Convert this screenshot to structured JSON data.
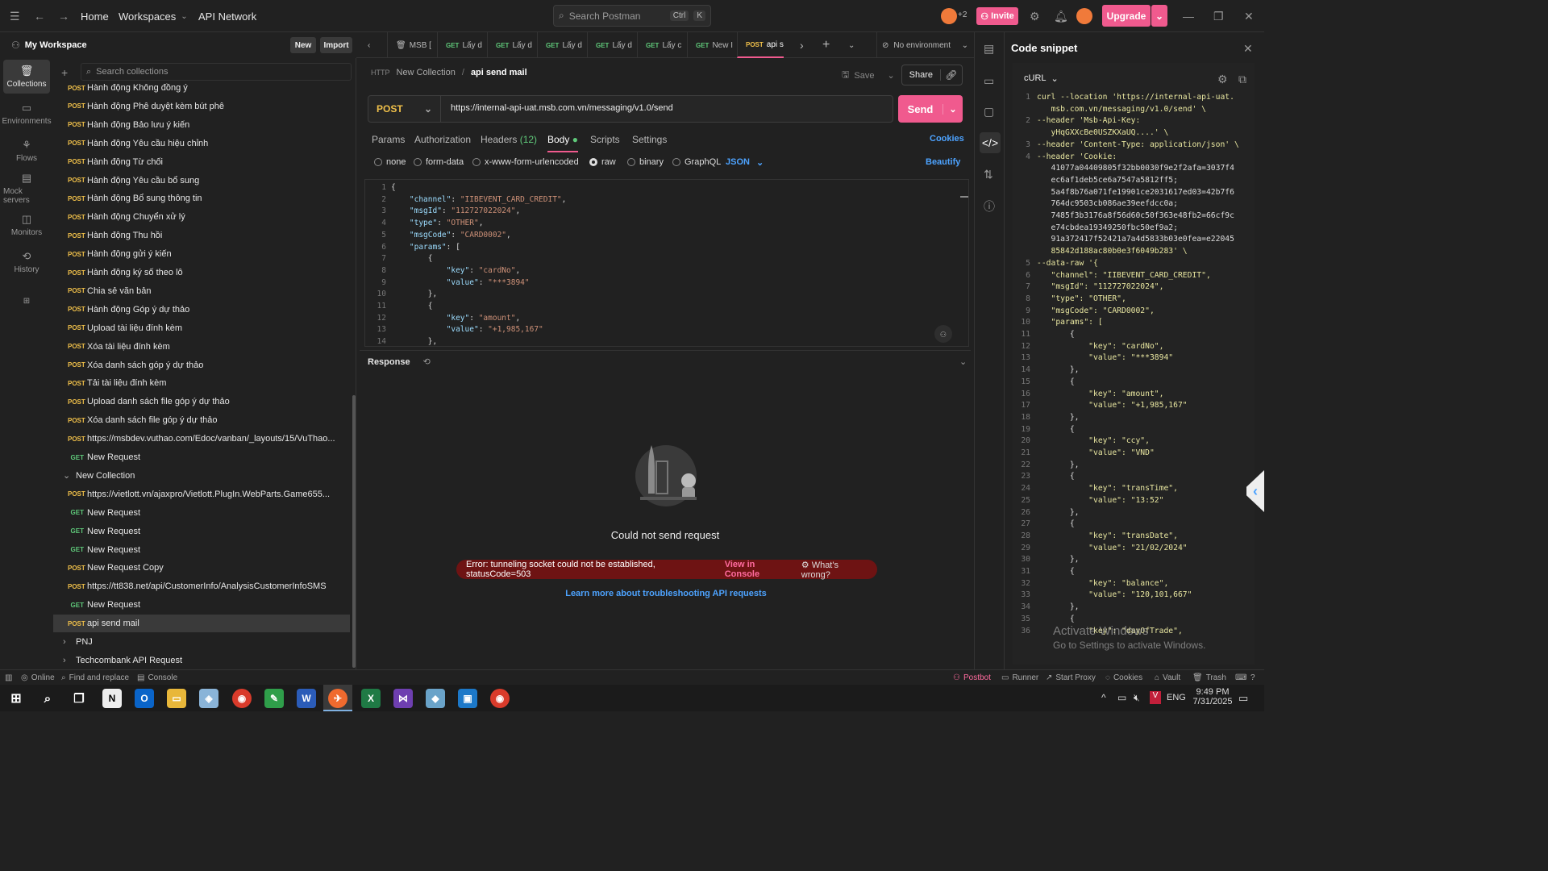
{
  "topbar": {
    "home": "Home",
    "workspaces": "Workspaces",
    "api_network": "API Network",
    "search_placeholder": "Search Postman",
    "kbd_ctrl": "Ctrl",
    "kbd_k": "K",
    "avatar_count": "+2",
    "invite": "Invite",
    "upgrade": "Upgrade"
  },
  "workspace": {
    "title": "My Workspace",
    "new": "New",
    "import": "Import",
    "search_placeholder": "Search collections"
  },
  "rail": [
    {
      "label": "Collections",
      "icon": "trash-can-icon"
    },
    {
      "label": "Environments",
      "icon": "environment-icon"
    },
    {
      "label": "Flows",
      "icon": "flows-icon"
    },
    {
      "label": "Mock servers",
      "icon": "mock-server-icon"
    },
    {
      "label": "Monitors",
      "icon": "monitor-icon"
    },
    {
      "label": "History",
      "icon": "history-icon"
    }
  ],
  "tree": [
    {
      "method": "POST",
      "label": "Hành động Không đồng ý"
    },
    {
      "method": "POST",
      "label": "Hành động Phê duyệt kèm bút phê"
    },
    {
      "method": "POST",
      "label": "Hành động Bảo lưu ý kiến"
    },
    {
      "method": "POST",
      "label": "Hành động Yêu cầu hiệu chỉnh"
    },
    {
      "method": "POST",
      "label": "Hành động Từ chối"
    },
    {
      "method": "POST",
      "label": "Hành động Yêu cầu bổ sung"
    },
    {
      "method": "POST",
      "label": "Hành động Bổ sung thông tin"
    },
    {
      "method": "POST",
      "label": "Hành động Chuyển xử lý"
    },
    {
      "method": "POST",
      "label": "Hành động Thu hồi"
    },
    {
      "method": "POST",
      "label": "Hành động gửi ý kiến"
    },
    {
      "method": "POST",
      "label": "Hành động ký số theo lô"
    },
    {
      "method": "POST",
      "label": "Chia sẻ văn bản"
    },
    {
      "method": "POST",
      "label": "Hành động Góp ý dự thảo"
    },
    {
      "method": "POST",
      "label": "Upload tài liệu đính kèm"
    },
    {
      "method": "POST",
      "label": "Xóa tài liệu đính kèm"
    },
    {
      "method": "POST",
      "label": "Xóa danh sách góp ý dự thảo"
    },
    {
      "method": "POST",
      "label": "Tải tài liệu đính kèm"
    },
    {
      "method": "POST",
      "label": "Upload danh sách file góp ý dự thảo"
    },
    {
      "method": "POST",
      "label": "Xóa danh sách file góp ý dự thảo"
    },
    {
      "method": "POST",
      "label": "https://msbdev.vuthao.com/Edoc/vanban/_layouts/15/VuThao..."
    },
    {
      "method": "GET",
      "label": "New Request"
    },
    {
      "method": "",
      "label": "New Collection",
      "folder": true,
      "open": true
    },
    {
      "method": "POST",
      "label": "https://vietlott.vn/ajaxpro/Vietlott.PlugIn.WebParts.Game655..."
    },
    {
      "method": "GET",
      "label": "New Request"
    },
    {
      "method": "GET",
      "label": "New Request"
    },
    {
      "method": "GET",
      "label": "New Request"
    },
    {
      "method": "POST",
      "label": "New Request Copy"
    },
    {
      "method": "POST",
      "label": "https://tt838.net/api/CustomerInfo/AnalysisCustomerInfoSMS"
    },
    {
      "method": "GET",
      "label": "New Request"
    },
    {
      "method": "POST",
      "label": "api send mail",
      "selected": true
    },
    {
      "method": "",
      "label": "PNJ",
      "folder": true
    },
    {
      "method": "",
      "label": "Techcombank API Request",
      "folder": true
    }
  ],
  "tabs": [
    {
      "method": "",
      "label": "MSB [",
      "icon": "trash-can-icon"
    },
    {
      "method": "GET",
      "label": "Lấy d"
    },
    {
      "method": "GET",
      "label": "Lấy d"
    },
    {
      "method": "GET",
      "label": "Lấy d"
    },
    {
      "method": "GET",
      "label": "Lấy d"
    },
    {
      "method": "GET",
      "label": "Lấy c",
      "dot": true
    },
    {
      "method": "GET",
      "label": "New I"
    },
    {
      "method": "POST",
      "label": "api s",
      "active": true
    }
  ],
  "environment": "No environment",
  "request": {
    "breadcrumb_collection": "New Collection",
    "breadcrumb_sep": "/",
    "name": "api send mail",
    "save": "Save",
    "share": "Share",
    "method": "POST",
    "url": "https://internal-api-uat.msb.com.vn/messaging/v1.0/send",
    "send": "Send",
    "cookies": "Cookies",
    "beautify": "Beautify",
    "body_format": "JSON"
  },
  "subtabs": {
    "params": "Params",
    "authorization": "Authorization",
    "headers": "Headers",
    "headers_count": "(12)",
    "body": "Body",
    "scripts": "Scripts",
    "settings": "Settings"
  },
  "body_types": [
    "none",
    "form-data",
    "x-www-form-urlencoded",
    "raw",
    "binary",
    "GraphQL"
  ],
  "body_selected": "raw",
  "editor_lines": [
    {
      "n": "1",
      "i": 0,
      "t": "{"
    },
    {
      "n": "2",
      "i": 1,
      "k": "\"channel\"",
      "v": "\"IIBEVENT_CARD_CREDIT\"",
      "e": ","
    },
    {
      "n": "3",
      "i": 1,
      "k": "\"msgId\"",
      "v": "\"112727022024\"",
      "e": ","
    },
    {
      "n": "4",
      "i": 1,
      "k": "\"type\"",
      "v": "\"OTHER\"",
      "e": ","
    },
    {
      "n": "5",
      "i": 1,
      "k": "\"msgCode\"",
      "v": "\"CARD0002\"",
      "e": ","
    },
    {
      "n": "6",
      "i": 1,
      "k": "\"params\"",
      "t": "["
    },
    {
      "n": "7",
      "i": 2,
      "t": "{"
    },
    {
      "n": "8",
      "i": 3,
      "k": "\"key\"",
      "v": "\"cardNo\"",
      "e": ","
    },
    {
      "n": "9",
      "i": 3,
      "k": "\"value\"",
      "v": "\"***3894\""
    },
    {
      "n": "10",
      "i": 2,
      "t": "},"
    },
    {
      "n": "11",
      "i": 2,
      "t": "{"
    },
    {
      "n": "12",
      "i": 3,
      "k": "\"key\"",
      "v": "\"amount\"",
      "e": ","
    },
    {
      "n": "13",
      "i": 3,
      "k": "\"value\"",
      "v": "\"+1,985,167\""
    },
    {
      "n": "14",
      "i": 2,
      "t": "},"
    }
  ],
  "response": {
    "title": "Response",
    "empty": "Could not send request",
    "error": "Error: tunneling socket could not be established, statusCode=503",
    "view_console": "View in Console",
    "whats_wrong": "What's wrong?",
    "learn_more": "Learn more about troubleshooting API requests"
  },
  "snippet": {
    "title": "Code snippet",
    "language": "cURL",
    "lines": [
      {
        "n": "1",
        "t": "curl --location 'https://internal-api-uat."
      },
      {
        "n": "",
        "t": "   msb.com.vn/messaging/v1.0/send' \\"
      },
      {
        "n": "2",
        "t": "--header 'Msb-Api-Key:"
      },
      {
        "n": "",
        "t": "   yHqGXXcBe0USZKXaUQ....' \\"
      },
      {
        "n": "3",
        "t": "--header 'Content-Type: application/json' \\"
      },
      {
        "n": "4",
        "t": "--header 'Cookie:"
      },
      {
        "n": "",
        "t": "   41077a04409805f32bb0030f9e2f2afa=3037f4"
      },
      {
        "n": "",
        "t": "   ec6af1deb5ce6a7547a5812ff5;"
      },
      {
        "n": "",
        "t": "   5a4f8b76a071fe19901ce2031617ed03=42b7f6"
      },
      {
        "n": "",
        "t": "   764dc9503cb086ae39eefdcc0a;"
      },
      {
        "n": "",
        "t": "   7485f3b3176a8f56d60c50f363e48fb2=66cf9c"
      },
      {
        "n": "",
        "t": "   e74cbdea19349250fbc50ef9a2;"
      },
      {
        "n": "",
        "t": "   91a372417f52421a7a4d5833b03e0fea=e22045"
      },
      {
        "n": "",
        "t": "   85842d188ac80b0e3f6049b283' \\"
      },
      {
        "n": "5",
        "t": "--data-raw '{"
      },
      {
        "n": "6",
        "t": "   \"channel\": \"IIBEVENT_CARD_CREDIT\","
      },
      {
        "n": "7",
        "t": "   \"msgId\": \"112727022024\","
      },
      {
        "n": "8",
        "t": "   \"type\": \"OTHER\","
      },
      {
        "n": "9",
        "t": "   \"msgCode\": \"CARD0002\","
      },
      {
        "n": "10",
        "t": "   \"params\": ["
      },
      {
        "n": "11",
        "t": "       {"
      },
      {
        "n": "12",
        "t": "           \"key\": \"cardNo\","
      },
      {
        "n": "13",
        "t": "           \"value\": \"***3894\""
      },
      {
        "n": "14",
        "t": "       },"
      },
      {
        "n": "15",
        "t": "       {"
      },
      {
        "n": "16",
        "t": "           \"key\": \"amount\","
      },
      {
        "n": "17",
        "t": "           \"value\": \"+1,985,167\""
      },
      {
        "n": "18",
        "t": "       },"
      },
      {
        "n": "19",
        "t": "       {"
      },
      {
        "n": "20",
        "t": "           \"key\": \"ccy\","
      },
      {
        "n": "21",
        "t": "           \"value\": \"VND\""
      },
      {
        "n": "22",
        "t": "       },"
      },
      {
        "n": "23",
        "t": "       {"
      },
      {
        "n": "24",
        "t": "           \"key\": \"transTime\","
      },
      {
        "n": "25",
        "t": "           \"value\": \"13:52\""
      },
      {
        "n": "26",
        "t": "       },"
      },
      {
        "n": "27",
        "t": "       {"
      },
      {
        "n": "28",
        "t": "           \"key\": \"transDate\","
      },
      {
        "n": "29",
        "t": "           \"value\": \"21/02/2024\""
      },
      {
        "n": "30",
        "t": "       },"
      },
      {
        "n": "31",
        "t": "       {"
      },
      {
        "n": "32",
        "t": "           \"key\": \"balance\","
      },
      {
        "n": "33",
        "t": "           \"value\": \"120,101,667\""
      },
      {
        "n": "34",
        "t": "       },"
      },
      {
        "n": "35",
        "t": "       {"
      },
      {
        "n": "36",
        "t": "           \"key\": \"dayOfTrade\","
      }
    ]
  },
  "watermark": {
    "line1": "Activate Windows",
    "line2": "Go to Settings to activate Windows."
  },
  "status": {
    "online": "Online",
    "find_replace": "Find and replace",
    "console": "Console",
    "postbot": "Postbot",
    "runner": "Runner",
    "start_proxy": "Start Proxy",
    "cookies": "Cookies",
    "vault": "Vault",
    "trash": "Trash"
  },
  "taskbar": {
    "lang": "ENG",
    "time": "9:49 PM",
    "date": "7/31/2025"
  },
  "colors": {
    "accent": "#f05a8e",
    "post": "#f0c04a",
    "get": "#5fc97a",
    "error_bg": "#6e1313",
    "link": "#4da3ff"
  }
}
